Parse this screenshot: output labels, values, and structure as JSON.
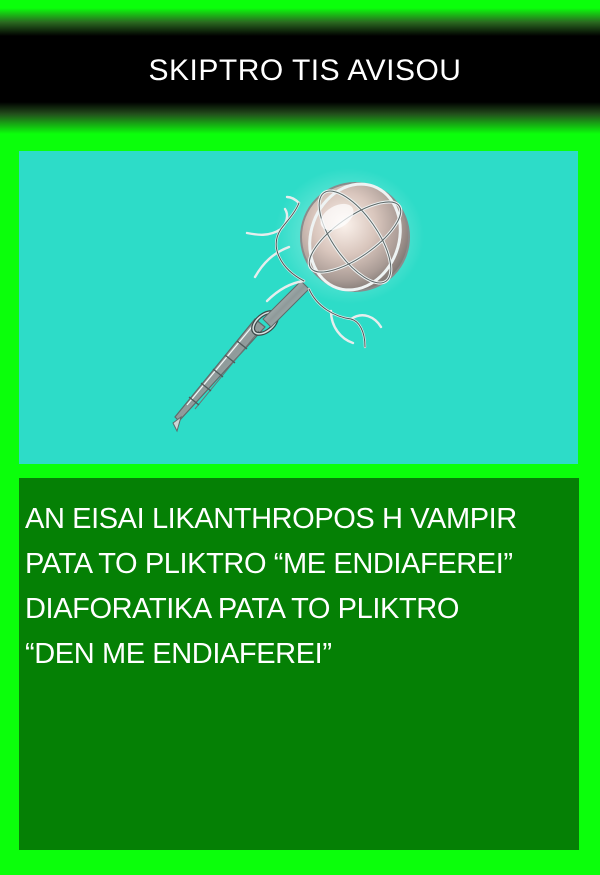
{
  "header": {
    "title": "SKIPTRO TIS AVISOU"
  },
  "item_image": {
    "icon": "scepter-icon",
    "background_color": "#2ddcc8"
  },
  "message": {
    "lines": [
      "AN EISAI LIKANTHROPOS H VAMPIR",
      "PATA TO PLIKTRO “ME ENDIAFEREI”",
      "DIAFORATIKA PATA TO PLIKTRO",
      "“DEN ME ENDIAFEREI”"
    ]
  },
  "colors": {
    "frame": "#0bff0b",
    "header_background": "#000000",
    "text_panel": "#058005",
    "text": "#ffffff"
  }
}
